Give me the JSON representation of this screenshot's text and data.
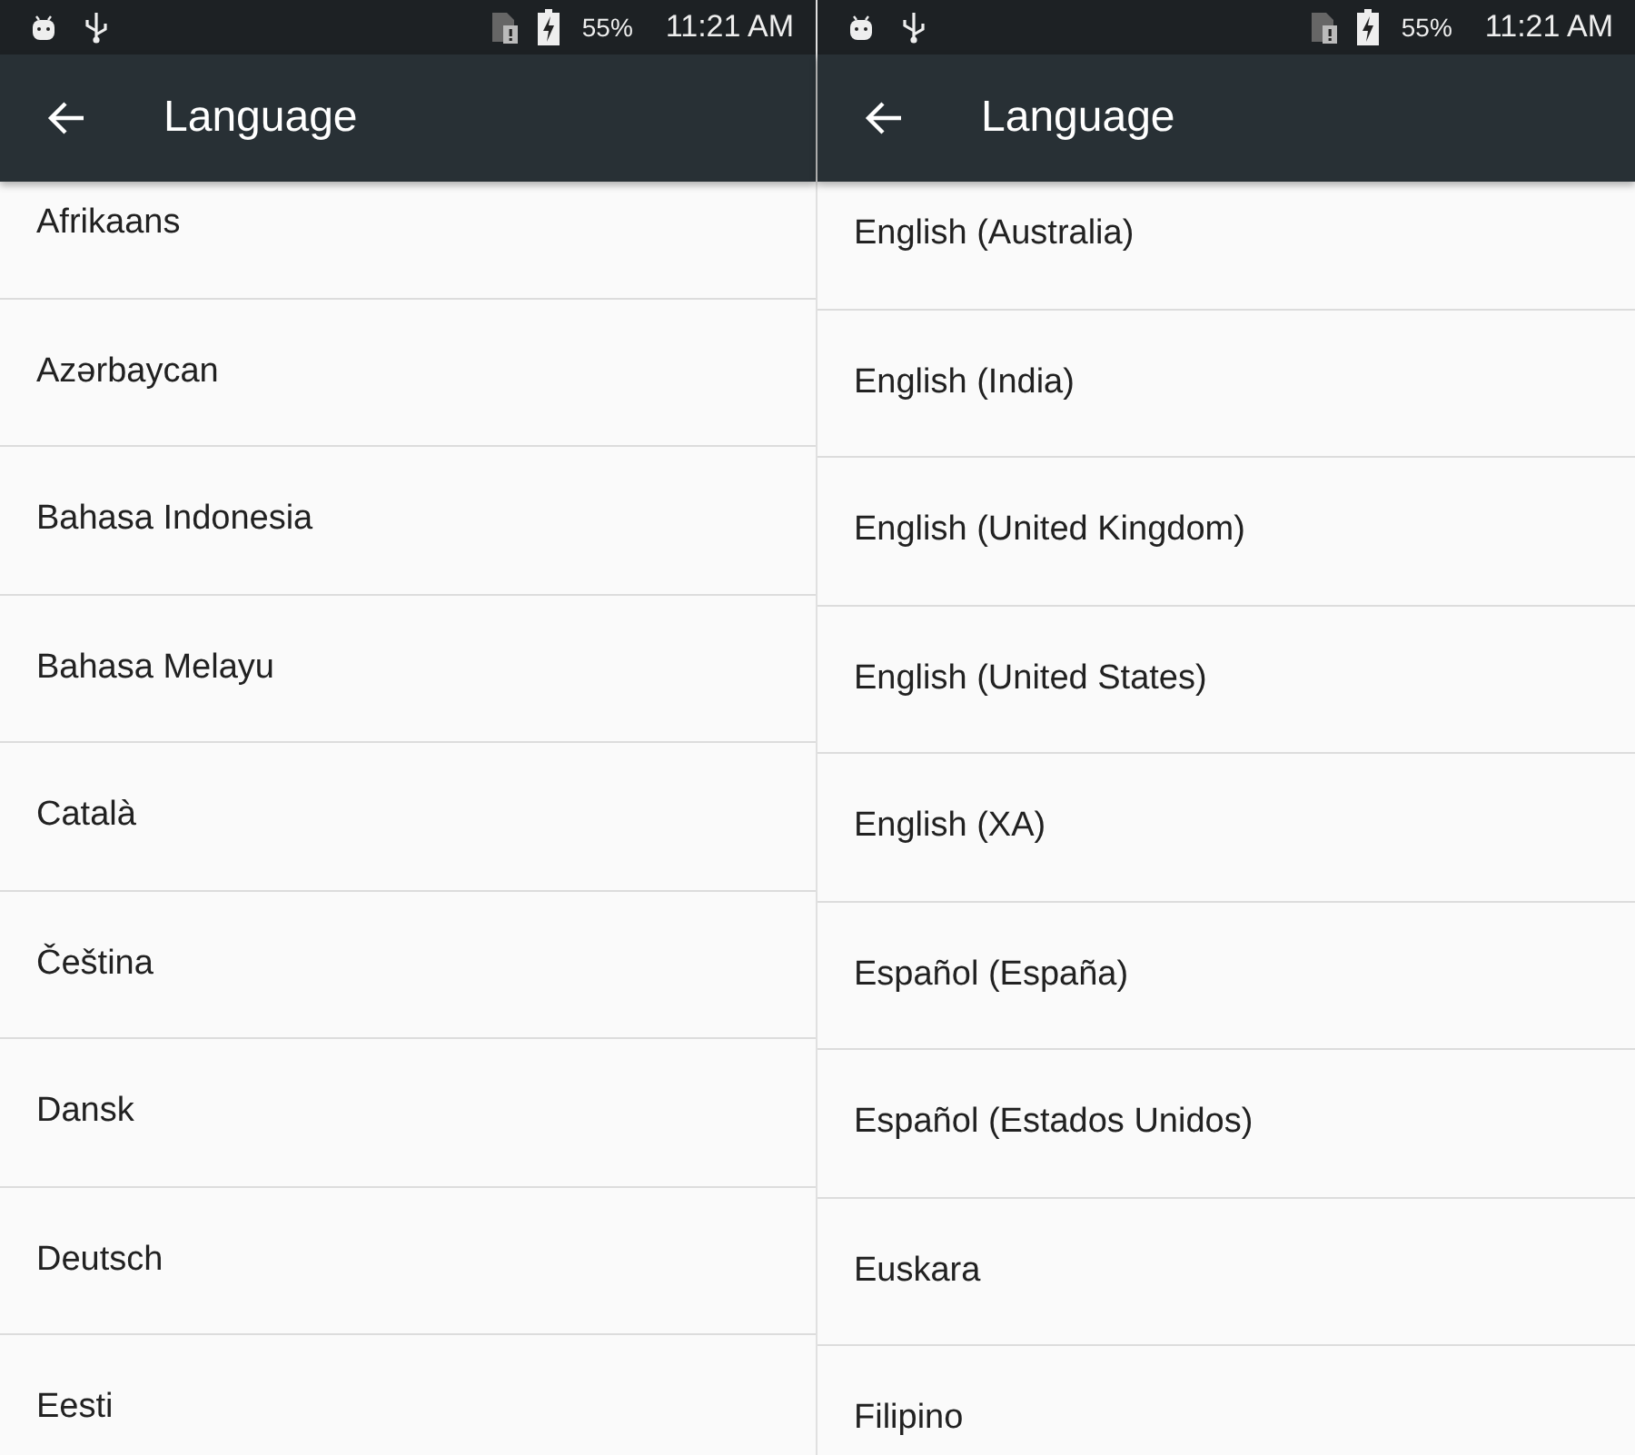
{
  "screens": [
    {
      "status_bar": {
        "battery": "55%",
        "time": "11:21 AM"
      },
      "app_bar": {
        "title": "Language"
      },
      "languages": [
        "Afrikaans",
        "Azərbaycan",
        "Bahasa Indonesia",
        "Bahasa Melayu",
        "Català",
        "Čeština",
        "Dansk",
        "Deutsch",
        "Eesti"
      ]
    },
    {
      "status_bar": {
        "battery": "55%",
        "time": "11:21 AM"
      },
      "app_bar": {
        "title": "Language"
      },
      "languages": [
        "English (Australia)",
        "English (India)",
        "English (United Kingdom)",
        "English (United States)",
        "English (XA)",
        "Español (España)",
        "Español (Estados Unidos)",
        "Euskara",
        "Filipino"
      ]
    }
  ]
}
